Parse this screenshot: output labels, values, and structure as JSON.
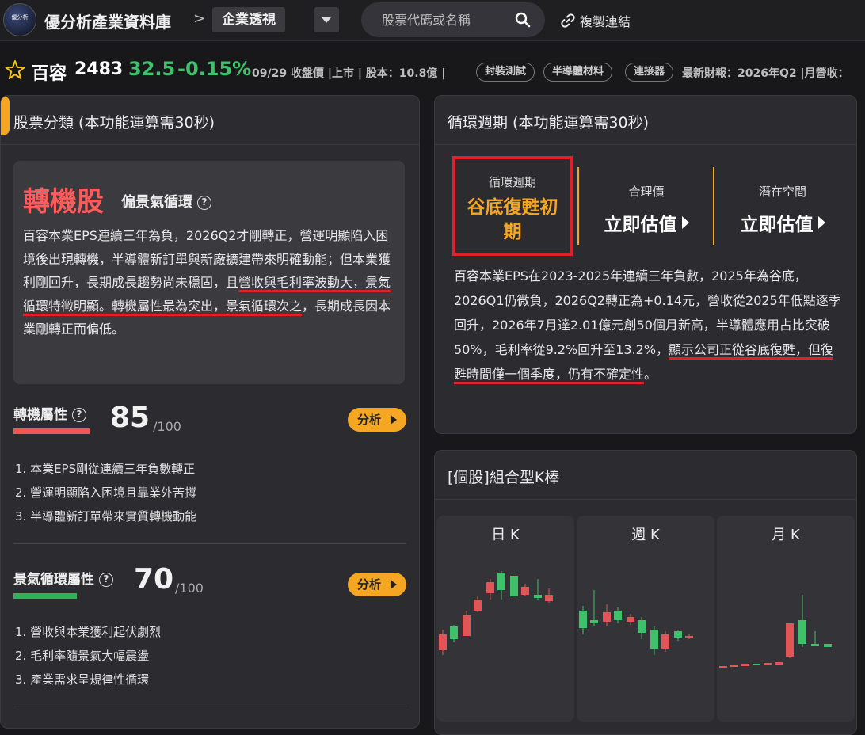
{
  "header": {
    "logo_text": "優分析",
    "site_title": "優分析產業資料庫",
    "breadcrumb_sep": ">",
    "section": "企業透視",
    "search_placeholder": "股票代碼或名稱",
    "copy_link": "複製連結"
  },
  "stock": {
    "name": "百容",
    "code": "2483",
    "price": "32.5",
    "change": "-0.15%",
    "meta": "09/29 收盤價 |上市 | 股本：10.8億 |",
    "tags": [
      "封裝測試",
      "半導體材料",
      "連接器"
    ],
    "meta2": "最新財報：2026年Q2 |月營收：",
    "price_color": "#3fc06a"
  },
  "classification": {
    "title": "股票分類 (本功能運算需30秒)",
    "type": "轉機股",
    "subtype": "偏景氣循環",
    "desc_part1": "百容本業EPS連續三年為負，2026Q2才剛轉正，營運明顯陷入困境後出現轉機，半導體新訂單與新廠擴建帶來明確動能；但本業獲利剛回升，長期成長趨勢尚未穩固，且",
    "desc_hl1": "營收與毛利率波動大，景氣循環特徵明顯。轉機",
    "desc_hl2": "屬性最為突出，景氣循環次之",
    "desc_part2": "，長期成長因本業剛轉正而偏低。",
    "attrs": [
      {
        "label": "轉機屬性",
        "score": "85",
        "max": "/100",
        "button": "分析",
        "color": "#f25555",
        "items": [
          "1. 本業EPS剛從連續三年負數轉正",
          "2. 營運明顯陷入困境且靠業外苦撐",
          "3. 半導體新訂單帶來實質轉機動能"
        ]
      },
      {
        "label": "景氣循環屬性",
        "score": "70",
        "max": "/100",
        "button": "分析",
        "color": "#2eb35a",
        "items": [
          "1. 營收與本業獲利起伏劇烈",
          "2. 毛利率隨景氣大幅震盪",
          "3. 產業需求呈規律性循環"
        ]
      }
    ]
  },
  "cycle": {
    "title": "循環週期 (本功能運算需30秒)",
    "cycle_label": "循環週期",
    "cycle_value": "谷底復甦初期",
    "fair_label": "合理價",
    "fair_button": "立即估值",
    "space_label": "潛在空間",
    "space_button": "立即估值",
    "desc_part1": "百容本業EPS在2023-2025年連續三年負數，2025年為谷底，2026Q1仍微負，2026Q2轉正為+0.14元，營收從2025年低點逐季回升，2026年7月達2.01億元創50個月新高，半導體應用占比突破50%，毛利率從9.2%回升至13.2%，",
    "desc_hl": "顯示公司正從谷底復甦，但復甦時間僅一個季度，仍有不確定性",
    "desc_part2": "。"
  },
  "kbar": {
    "title": "[個股]組合型K棒",
    "panels": [
      "日 K",
      "週 K",
      "月 K"
    ],
    "up_color": "#e05555",
    "down_color": "#3fc06a"
  }
}
